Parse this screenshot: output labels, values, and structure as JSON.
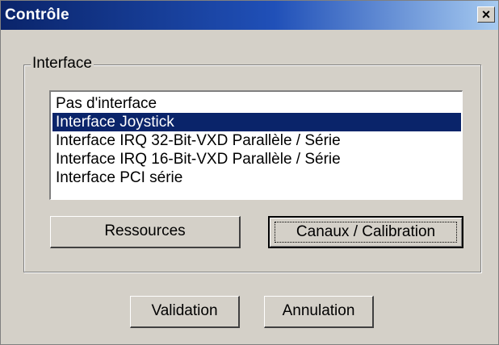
{
  "window": {
    "title": "Contrôle",
    "close_label": "×"
  },
  "group": {
    "label": "Interface"
  },
  "listbox": {
    "items": [
      "Pas d'interface",
      "Interface Joystick",
      "Interface IRQ 32-Bit-VXD Parallèle / Série",
      "Interface IRQ 16-Bit-VXD Parallèle / Série",
      "Interface PCI série"
    ],
    "selected": "Interface Joystick"
  },
  "buttons": {
    "resources": "Ressources",
    "channels": "Canaux / Calibration",
    "ok": "Validation",
    "cancel": "Annulation"
  },
  "colors": {
    "selection": "#0a246a",
    "face": "#d4d0c8",
    "title_bar": "#0a246a"
  }
}
